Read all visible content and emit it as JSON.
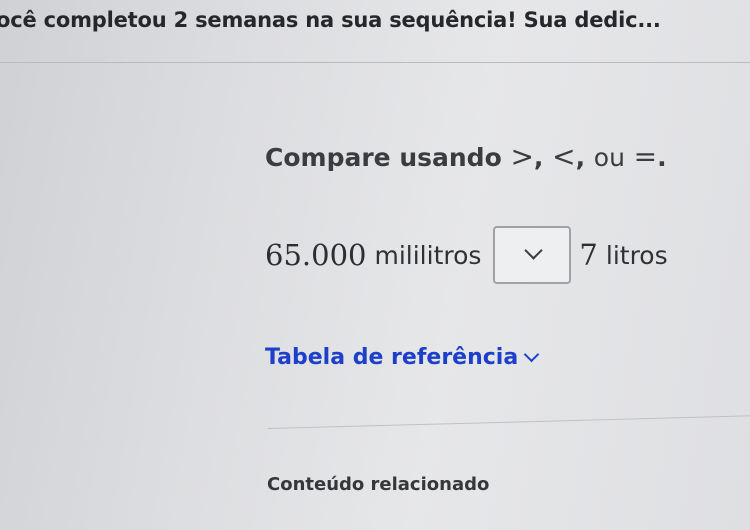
{
  "banner": {
    "text": "ocê completou 2 semanas na sua sequência! Sua dedic..."
  },
  "prompt": {
    "lead": "Compare usando ",
    "symbols": [
      ">",
      "<"
    ],
    "or_word": "ou",
    "equals": "=",
    "comma": ", ",
    "period": "."
  },
  "question": {
    "left_value": "65.000",
    "left_unit": "mililitros",
    "comparison_select": {
      "selected": ""
    },
    "right_value": "7",
    "right_unit": "litros"
  },
  "reference_table": {
    "label": "Tabela de referência"
  },
  "related_content": {
    "label": "Conteúdo relacionado"
  },
  "icons": {
    "select_chevron": "chevron-down-icon",
    "reference_chevron": "chevron-down-icon"
  },
  "colors": {
    "link": "#1d3fc9",
    "text": "#2e3033"
  }
}
